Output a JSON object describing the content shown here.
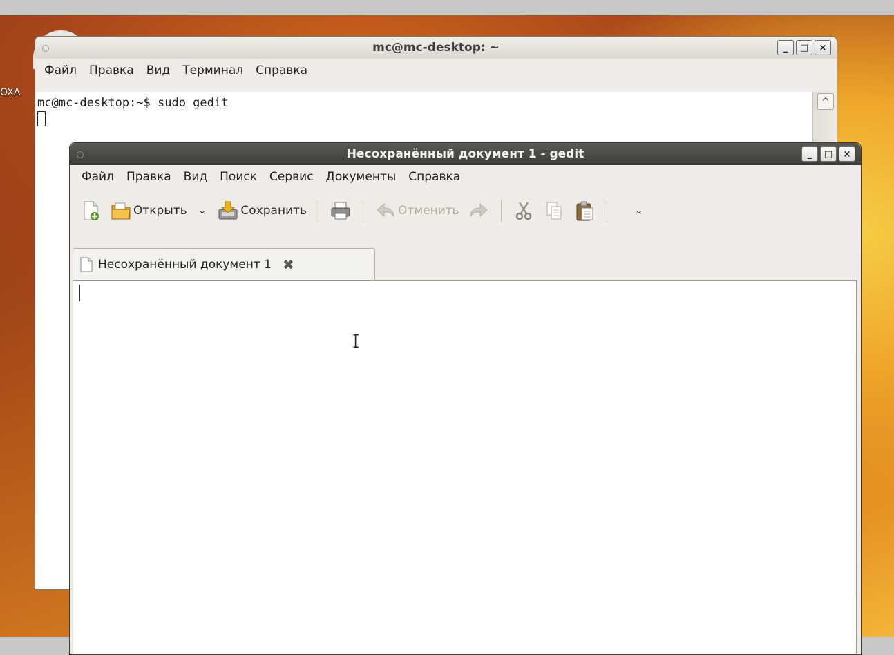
{
  "desktop": {
    "left_label": "OXA"
  },
  "terminal": {
    "title": "mc@mc-desktop: ~",
    "menu": [
      {
        "first": "Ф",
        "rest": "айл"
      },
      {
        "first": "П",
        "rest": "равка"
      },
      {
        "first": "В",
        "rest": "ид"
      },
      {
        "first": "Т",
        "rest": "ерминал"
      },
      {
        "first": "С",
        "rest": "правка"
      }
    ],
    "prompt_line": "mc@mc-desktop:~$ sudo gedit"
  },
  "gedit": {
    "title": "Несохранённый документ 1 - gedit",
    "menu": [
      "Файл",
      "Правка",
      "Вид",
      "Поиск",
      "Сервис",
      "Документы",
      "Справка"
    ],
    "toolbar": {
      "open_label": "Открыть",
      "save_label": "Сохранить",
      "undo_label": "Отменить"
    },
    "tab_label": "Несохранённый документ 1"
  },
  "window_controls": {
    "minimize": "_",
    "maximize": "□",
    "close": "×"
  },
  "icons": {
    "new": "new-document-icon",
    "open": "folder-open-icon",
    "save": "save-icon",
    "print": "print-icon",
    "undo": "undo-icon",
    "redo": "redo-icon",
    "cut": "scissors-icon",
    "copy": "copy-icon",
    "paste": "paste-icon"
  },
  "colors": {
    "gedit_titlebar": "#3d3c38",
    "chrome_bg": "#efebe7",
    "accent_orange": "#e4901f"
  }
}
